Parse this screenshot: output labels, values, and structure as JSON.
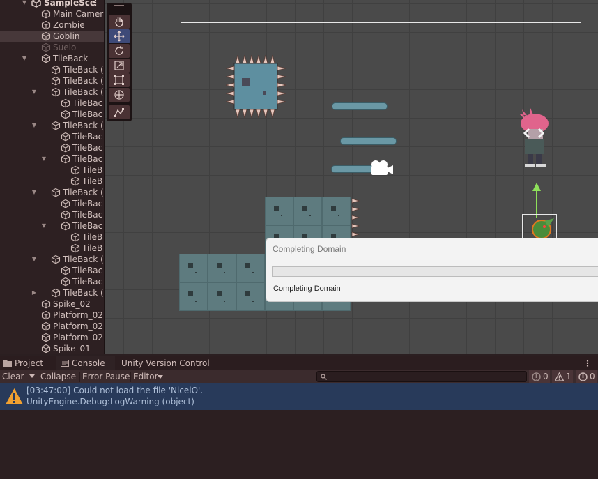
{
  "hierarchy": {
    "scene_name": "SampleSce",
    "items": [
      {
        "label": "Main Camera"
      },
      {
        "label": "Zombie"
      },
      {
        "label": "Goblin"
      },
      {
        "label": "Suelo"
      },
      {
        "label": "TileBack"
      },
      {
        "label": "TileBack ("
      },
      {
        "label": "TileBack ("
      },
      {
        "label": "TileBack ("
      },
      {
        "label": "TileBac"
      },
      {
        "label": "TileBac"
      },
      {
        "label": "TileBack ("
      },
      {
        "label": "TileBac"
      },
      {
        "label": "TileBac"
      },
      {
        "label": "TileBac"
      },
      {
        "label": "TileB"
      },
      {
        "label": "TileB"
      },
      {
        "label": "TileBack ("
      },
      {
        "label": "TileBac"
      },
      {
        "label": "TileBac"
      },
      {
        "label": "TileBac"
      },
      {
        "label": "TileB"
      },
      {
        "label": "TileB"
      },
      {
        "label": "TileBack ("
      },
      {
        "label": "TileBac"
      },
      {
        "label": "TileBac"
      },
      {
        "label": "TileBack ("
      },
      {
        "label": "Spike_02"
      },
      {
        "label": "Platform_02"
      },
      {
        "label": "Platform_02"
      },
      {
        "label": "Platform_02"
      },
      {
        "label": "Spike_01"
      }
    ]
  },
  "dialog": {
    "title": "Completing Domain",
    "message": "Completing Domain",
    "progress": 0
  },
  "tabs": {
    "project": "Project",
    "console": "Console",
    "version_control": "Unity Version Control"
  },
  "toolbar": {
    "clear": "Clear",
    "collapse": "Collapse",
    "error_pause": "Error Pause",
    "editor": "Editor",
    "search_placeholder": "",
    "error_count": "0",
    "warning_count": "1",
    "info_count": "0"
  },
  "log": {
    "line1": "[03:47:00] Could not load the file 'NicelO'.",
    "line2": "UnityEngine.Debug:LogWarning (object)"
  },
  "colors": {
    "selection": "#47383a",
    "log_highlight": "#283a5a",
    "warning": "#f0a030",
    "tool_active": "#3e4a78"
  }
}
